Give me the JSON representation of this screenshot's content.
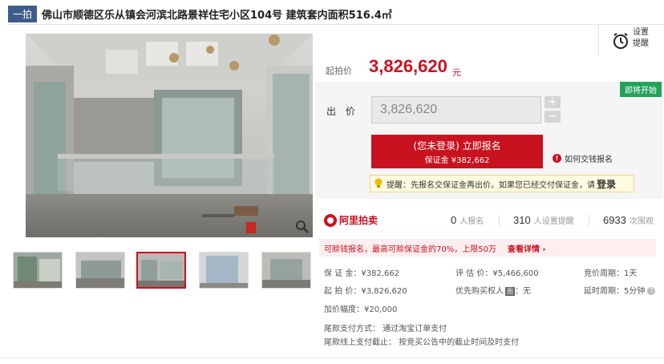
{
  "header": {
    "tag": "一拍",
    "title": "佛山市顺德区乐从镇会河滨北路景祥住宅小区104号 建筑套内面积516.4㎡"
  },
  "remind": {
    "label": "设置提醒",
    "icon": "alarm-clock-icon"
  },
  "price": {
    "start_label": "起拍价",
    "start_value": "3,826,620",
    "unit": "元"
  },
  "bid": {
    "badge": "即将开始",
    "label": "出 价",
    "input_value": "3,826,620",
    "plus": "+",
    "minus": "−",
    "signup_main": "(您未登录) 立即报名",
    "signup_sub": "保证金 ¥382,662",
    "how_link": "如何交钱报名",
    "tip_text": "提醒：先报名交保证金再出价。如果您已经交付保证金，请",
    "tip_login": "登录"
  },
  "stats": {
    "brand": "阿里拍卖",
    "signups_num": "0",
    "signups_label": "人报名",
    "reminders_num": "310",
    "reminders_label": "人设置提醒",
    "views_num": "6933",
    "views_label": "次围观"
  },
  "credit": {
    "text": "可赊钱报名，最高可赊保证金的70%，上限50万",
    "link": "查看详情 ›"
  },
  "info": {
    "deposit": "保 证 金：¥382,662",
    "appraisal": "评 估 价：¥5,466,600",
    "cycle": "竞价周期：1天",
    "start": "起 拍 价：¥3,826,620",
    "priority": "优先购买权人",
    "priority_badge": "图",
    "priority_val": "：无",
    "delay": "延时周期：5分钟",
    "increment": "加价幅度：¥20,000",
    "balance_pay": "尾款支付方式：  通过淘宝订单支付",
    "balance_deadline": "尾款线上支付截止：  按竞买公告中的截止时间及时支付"
  },
  "colors": {
    "accent": "#c9121f",
    "tag_bg": "#3d5c8a",
    "badge_green": "#23a35a"
  }
}
